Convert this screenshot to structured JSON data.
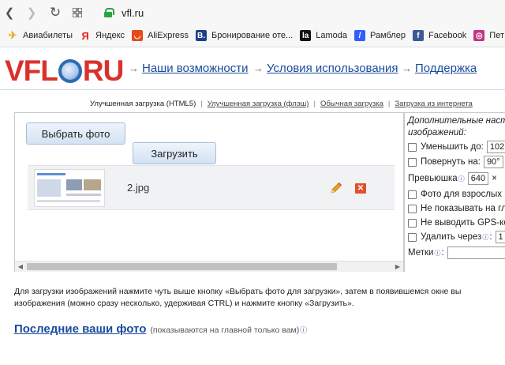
{
  "browser": {
    "url": "vfl.ru",
    "bookmarks": [
      {
        "label": "Авиабилеты",
        "icon": "plane-icon",
        "color": "#f0a818"
      },
      {
        "label": "Яндекс",
        "icon": "yandex-icon",
        "color": "#e52620"
      },
      {
        "label": "AliExpress",
        "icon": "aliexpress-icon",
        "color": "#e64a19"
      },
      {
        "label": "Бронирование оте...",
        "icon": "booking-icon",
        "color": "#1e3f8a"
      },
      {
        "label": "Lamoda",
        "icon": "lamoda-icon",
        "color": "#111111"
      },
      {
        "label": "Рамблер",
        "icon": "rambler-icon",
        "color": "#315efb"
      },
      {
        "label": "Facebook",
        "icon": "facebook-icon",
        "color": "#3b5998"
      },
      {
        "label": "Пет",
        "icon": "instagram-icon",
        "color": "#c13584"
      }
    ]
  },
  "site": {
    "logo_left": "VFL",
    "logo_right": "RU",
    "nav": [
      "Наши возможности",
      "Условия использования",
      "Поддержка"
    ]
  },
  "upload_tabs": [
    "Улучшенная загрузка (HTML5)",
    "Улучшенная загрузка (флэш)",
    "Обычная загрузка",
    "Загрузка из интернета"
  ],
  "uploader": {
    "choose_button": "Выбрать фото",
    "upload_button": "Загрузить",
    "files": [
      {
        "name": "2.jpg"
      }
    ]
  },
  "settings": {
    "title": "Дополнительные настройки изображений:",
    "resize_label": "Уменьшить до:",
    "resize_value": "102",
    "rotate_label": "Повернуть на:",
    "rotate_value": "90°",
    "preview_label": "Превьюшка",
    "preview_value": "640",
    "preview_x": "×",
    "adult_label": "Фото для взрослых",
    "hide_label": "Не показывать на гл",
    "gps_label": "Не выводить GPS-ко",
    "delete_label": "Удалить через",
    "delete_value": "1",
    "tags_label": "Метки"
  },
  "help": {
    "line1": "Для загрузки изображений нажмите чуть выше кнопку «Выбрать фото для загрузки», затем в появившемся окне вы",
    "line2": "изображения (можно сразу несколько, удерживая CTRL) и нажмите кнопку «Загрузить»."
  },
  "recent": {
    "link": "Последние ваши фото",
    "note": "(показываются на главной только вам)"
  }
}
